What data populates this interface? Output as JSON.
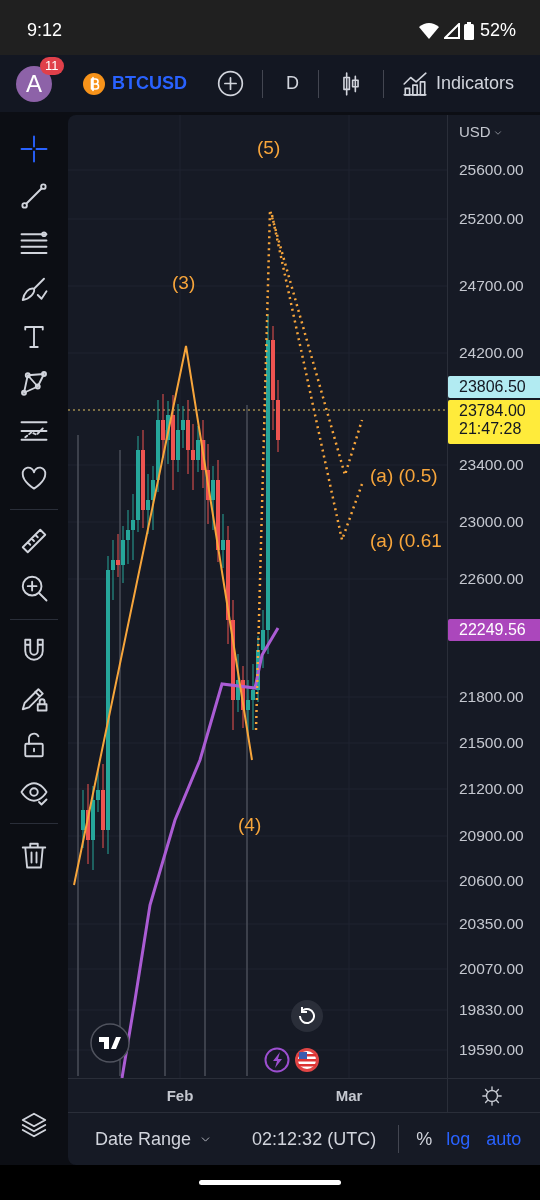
{
  "status_bar": {
    "time": "9:12",
    "battery": "52%"
  },
  "toolbar": {
    "avatar_letter": "A",
    "notification_count": "11",
    "symbol": "BTCUSD",
    "interval": "D",
    "indicators_label": "Indicators"
  },
  "tool_groups": [
    [
      {
        "kind": "crosshair",
        "selected": true
      },
      {
        "kind": "trendline",
        "selected": false
      },
      {
        "kind": "fib",
        "selected": false
      },
      {
        "kind": "brush",
        "selected": false
      },
      {
        "kind": "text",
        "selected": false
      },
      {
        "kind": "pattern",
        "selected": false
      },
      {
        "kind": "forecast",
        "selected": false
      },
      {
        "kind": "heart",
        "selected": false
      }
    ],
    [
      {
        "kind": "ruler",
        "selected": false
      },
      {
        "kind": "zoom",
        "selected": false
      }
    ],
    [
      {
        "kind": "magnet",
        "selected": false
      },
      {
        "kind": "pencil-lock",
        "selected": false
      },
      {
        "kind": "lock",
        "selected": false
      },
      {
        "kind": "eye",
        "selected": false
      }
    ],
    [
      {
        "kind": "trash",
        "selected": false
      }
    ]
  ],
  "chart": {
    "currency": "USD",
    "price_labels": [
      "25600.00",
      "25200.00",
      "24700.00",
      "24200.00",
      "23400.00",
      "23000.00",
      "22600.00",
      "21800.00",
      "21500.00",
      "21200.00",
      "20900.00",
      "20600.00",
      "20350.00",
      "20070.00",
      "19830.00",
      "19590.00"
    ],
    "last_price": "23806.50",
    "current_price": "23784.00",
    "countdown": "21:47:28",
    "ma_value": "22249.56",
    "wave_labels": [
      "(5)",
      "(3)",
      "(4)",
      "(a) (0.5)",
      "(a) (0.61"
    ],
    "time_labels": [
      "Feb",
      "Mar"
    ]
  },
  "bottom_bar": {
    "date_range": "Date Range",
    "clock": "02:12:32 (UTC)",
    "percent": "%",
    "log": "log",
    "auto": "auto"
  }
}
